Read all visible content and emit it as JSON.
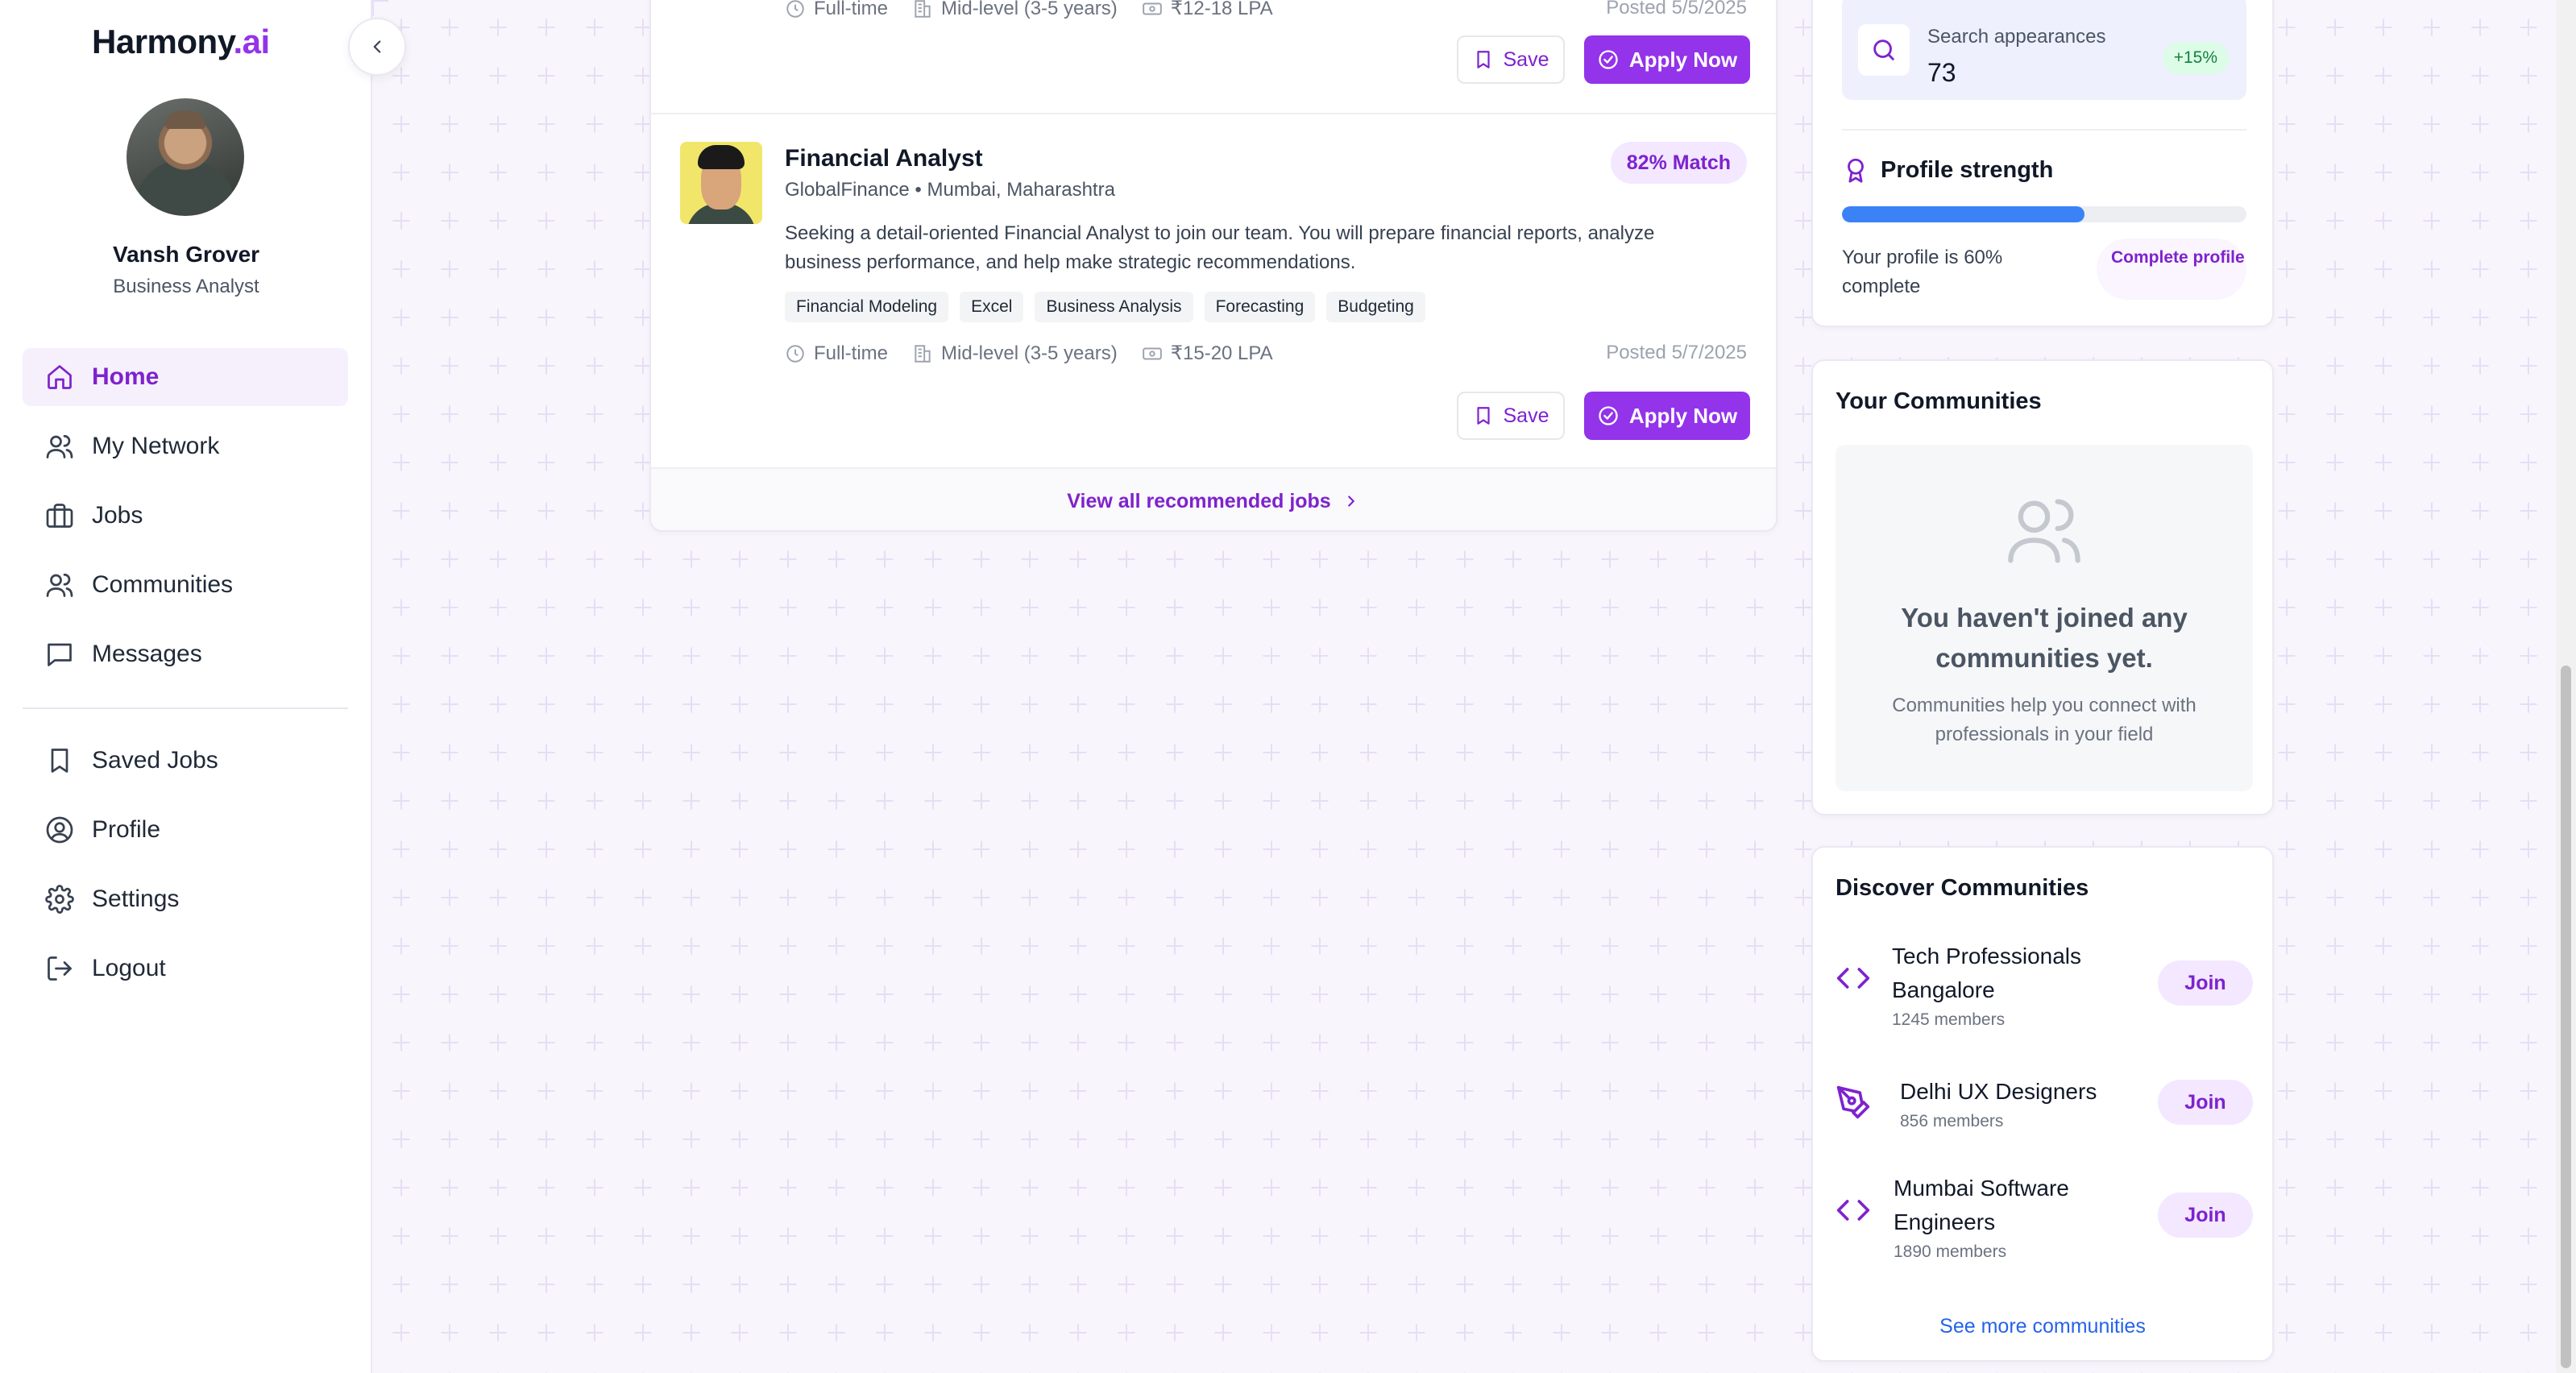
{
  "brand": {
    "name": "Harmony",
    "suffix": ".ai"
  },
  "user": {
    "name": "Vansh Grover",
    "role": "Business Analyst"
  },
  "nav": {
    "primary": [
      {
        "label": "Home",
        "icon": "home-icon",
        "active": true
      },
      {
        "label": "My Network",
        "icon": "users-icon"
      },
      {
        "label": "Jobs",
        "icon": "briefcase-icon"
      },
      {
        "label": "Communities",
        "icon": "users-icon"
      },
      {
        "label": "Messages",
        "icon": "message-icon"
      }
    ],
    "secondary": [
      {
        "label": "Saved Jobs",
        "icon": "bookmark-icon"
      },
      {
        "label": "Profile",
        "icon": "user-circle-icon"
      },
      {
        "label": "Settings",
        "icon": "gear-icon"
      },
      {
        "label": "Logout",
        "icon": "logout-icon"
      }
    ]
  },
  "jobs": {
    "previous": {
      "type": "Full-time",
      "level": "Mid-level (3-5 years)",
      "salary": "₹12-18 LPA",
      "posted": "Posted 5/5/2025",
      "save_label": "Save",
      "apply_label": "Apply Now"
    },
    "current": {
      "title": "Financial Analyst",
      "company": "GlobalFinance • Mumbai, Maharashtra",
      "match": "82% Match",
      "description": "Seeking a detail-oriented Financial Analyst to join our team. You will prepare financial reports, analyze business performance, and help make strategic recommendations.",
      "tags": [
        "Financial Modeling",
        "Excel",
        "Business Analysis",
        "Forecasting",
        "Budgeting"
      ],
      "type": "Full-time",
      "level": "Mid-level (3-5 years)",
      "salary": "₹15-20 LPA",
      "posted": "Posted 5/7/2025",
      "save_label": "Save",
      "apply_label": "Apply Now"
    },
    "view_all_label": "View all recommended jobs"
  },
  "stats": {
    "search_label": "Search appearances",
    "search_value": "73",
    "search_change": "+15%",
    "strength_title": "Profile strength",
    "strength_percent": 60,
    "strength_note": "Your profile is 60% complete",
    "complete_label": "Complete profile"
  },
  "your_communities": {
    "title": "Your Communities",
    "empty_title": "You haven't joined any communities yet.",
    "empty_sub": "Communities help you connect with professionals in your field"
  },
  "discover": {
    "title": "Discover Communities",
    "items": [
      {
        "name": "Tech Professionals Bangalore",
        "members": "1245 members",
        "icon": "code-icon",
        "join": "Join"
      },
      {
        "name": "Delhi UX Designers",
        "members": "856 members",
        "icon": "pen-tool-icon",
        "join": "Join"
      },
      {
        "name": "Mumbai Software Engineers",
        "members": "1890 members",
        "icon": "code-icon",
        "join": "Join"
      }
    ],
    "see_more": "See more communities"
  },
  "colors": {
    "accent": "#9333ea",
    "progress": "#3b82f6",
    "link": "#2563eb"
  }
}
